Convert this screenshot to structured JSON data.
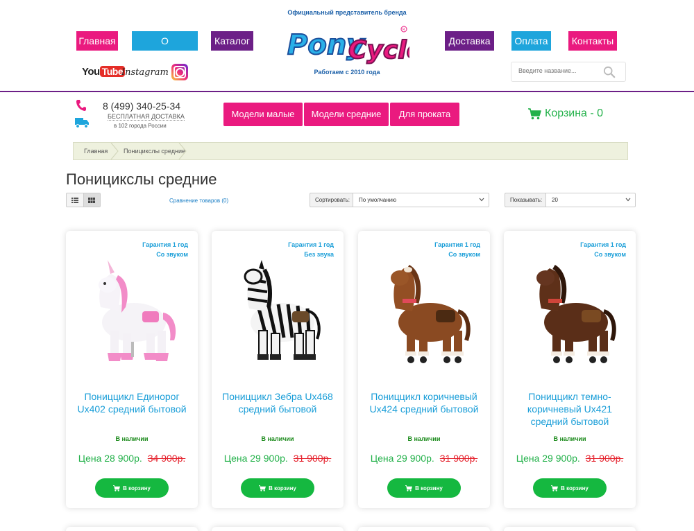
{
  "header": {
    "tagline_top": "Официальный представитель бренда",
    "tagline_bottom": "Работаем с 2010 года",
    "logo_text": "PonyCycle",
    "nav_left": [
      "Главная",
      "О поницикслах",
      "Каталог"
    ],
    "nav_right": [
      "Доставка",
      "Оплата",
      "Контакты"
    ],
    "youtube_you": "You",
    "youtube_tube": "Tube",
    "instagram": "Instagram",
    "search_placeholder": "Введите название..."
  },
  "contact": {
    "phone": "8 (499) 340-25-34",
    "free_shipping": "БЕСПЛАТНАЯ ДОСТАВКА",
    "cities": "в 102 города России"
  },
  "categories": [
    "Модели малые",
    "Модели средние",
    "Для проката"
  ],
  "cart": {
    "label": "Корзина - 0"
  },
  "breadcrumb": [
    "Главная",
    "Поницикслы средние"
  ],
  "page": {
    "title": "Поницикслы средние",
    "compare": "Сравнение товаров (0)",
    "sort_label": "Сортировать:",
    "sort_value": "По умолчанию",
    "show_label": "Показывать:",
    "show_value": "20"
  },
  "products": [
    {
      "warranty": "Гарантия 1 год",
      "sound": "Со звуком",
      "name": "Пониццикл Единорог Ux402 средний бытовой",
      "stock": "В наличии",
      "price": "Цена 28 900р.",
      "old_price": "34 900р.",
      "buy": "В корзину",
      "image": "unicorn"
    },
    {
      "warranty": "Гарантия 1 год",
      "sound": "Без звука",
      "name": "Пониццикл Зебра Ux468 средний бытовой",
      "stock": "В наличии",
      "price": "Цена 29 900р.",
      "old_price": "31 900р.",
      "buy": "В корзину",
      "image": "zebra"
    },
    {
      "warranty": "Гарантия 1 год",
      "sound": "Со звуком",
      "name": "Пониццикл коричневый Ux424 средний бытовой",
      "stock": "В наличии",
      "price": "Цена 29 900р.",
      "old_price": "31 900р.",
      "buy": "В корзину",
      "image": "brown-horse"
    },
    {
      "warranty": "Гарантия 1 год",
      "sound": "Со звуком",
      "name": "Пониццикл темно-коричневый Ux421 средний бытовой",
      "stock": "В наличии",
      "price": "Цена 29 900р.",
      "old_price": "31 900р.",
      "buy": "В корзину",
      "image": "dark-brown-horse"
    }
  ],
  "colors": {
    "pink": "#ea1a7f",
    "cyan": "#1ea5dc",
    "purple": "#6c1f87",
    "green": "#23b14a",
    "red": "#e5212c",
    "link": "#1a9ed8"
  }
}
